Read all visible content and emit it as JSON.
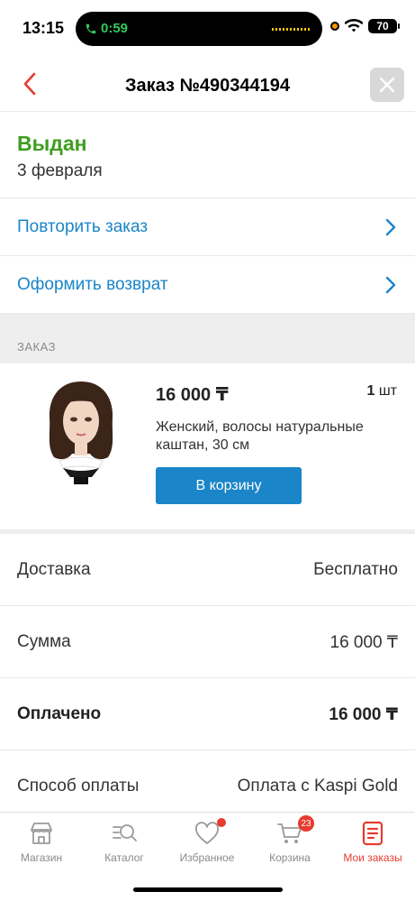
{
  "status_bar": {
    "time": "13:15",
    "call_timer": "0:59",
    "battery": "70"
  },
  "header": {
    "title": "Заказ №490344194"
  },
  "order_status": {
    "status": "Выдан",
    "date": "3 февраля",
    "status_color": "#3e9d1f"
  },
  "actions": {
    "repeat_label": "Повторить заказ",
    "return_label": "Оформить возврат"
  },
  "order_section": {
    "title": "ЗАКАЗ"
  },
  "product": {
    "price": "16 000 ₸",
    "qty_number": "1",
    "qty_unit": "шт",
    "name": "Женский, волосы натуральные каштан, 30 см",
    "cart_button_label": "В корзину"
  },
  "summary": [
    {
      "key": "Доставка",
      "value": "Бесплатно"
    },
    {
      "key": "Сумма",
      "value": "16 000 ₸"
    },
    {
      "key": "Оплачено",
      "value": "16 000 ₸"
    },
    {
      "key": "Способ оплаты",
      "value": "Оплата с Kaspi Gold"
    }
  ],
  "bottom_nav": {
    "items": [
      {
        "label": "Магазин",
        "icon": "store-icon"
      },
      {
        "label": "Каталог",
        "icon": "catalog-search-icon"
      },
      {
        "label": "Избранное",
        "icon": "heart-icon"
      },
      {
        "label": "Корзина",
        "icon": "cart-icon",
        "badge": "23"
      },
      {
        "label": "Мои заказы",
        "icon": "orders-icon"
      }
    ],
    "active_color": "#e63b2e"
  },
  "colors": {
    "accent_blue": "#1a85c8",
    "brand_red": "#e63b2e"
  }
}
